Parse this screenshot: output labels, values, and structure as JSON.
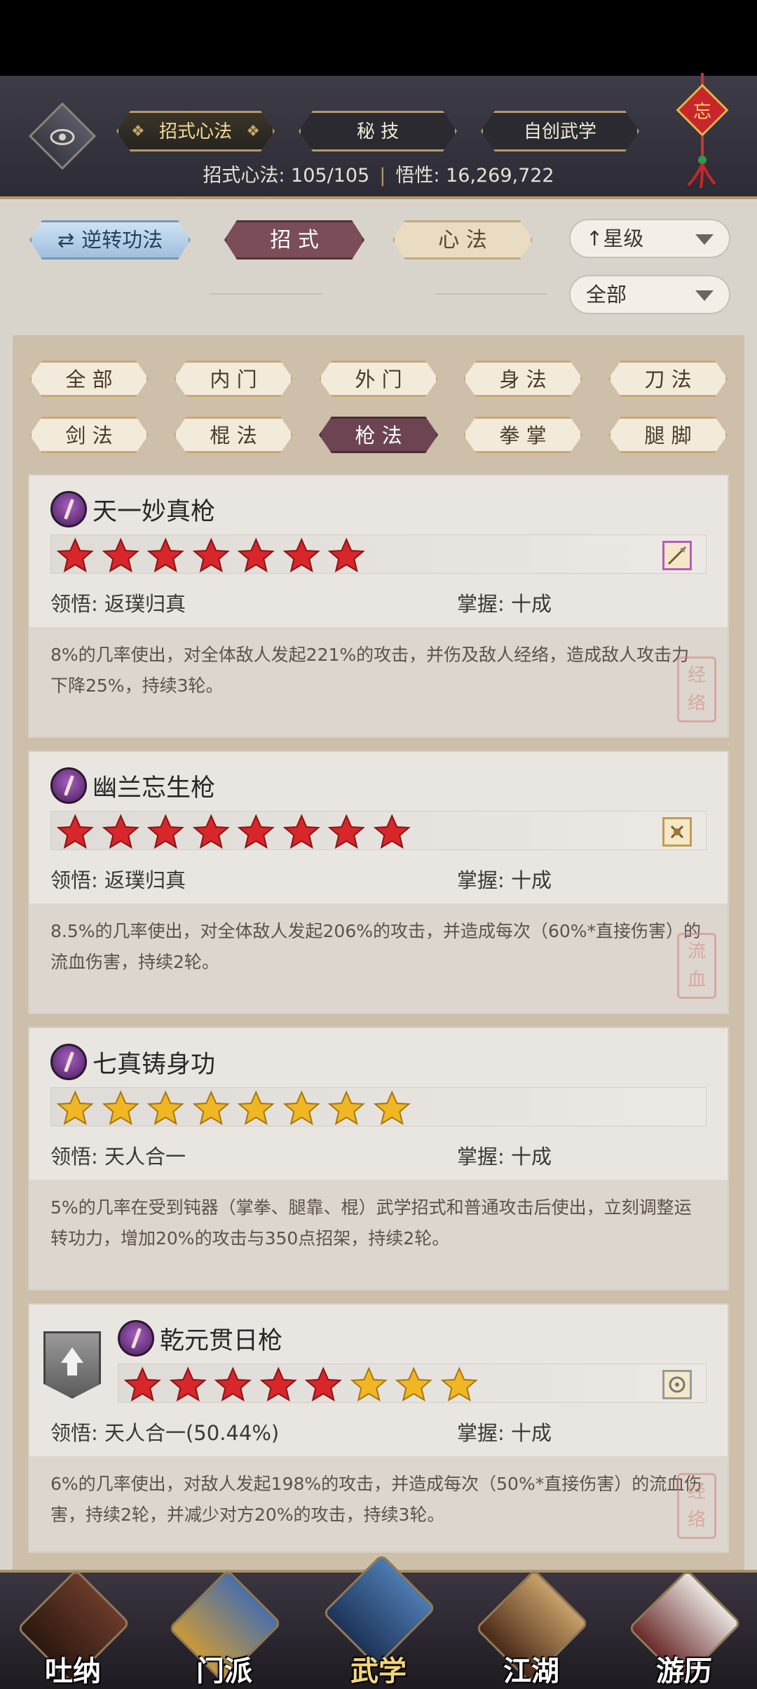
{
  "header": {
    "tabs": [
      {
        "label": "招式心法",
        "active": true
      },
      {
        "label": "秘 技",
        "active": false
      },
      {
        "label": "自创武学",
        "active": false
      }
    ],
    "stats_label": "招式心法: 105/105",
    "wisdom_label": "悟性: 16,269,722",
    "ornament_char": "忘"
  },
  "toolbar": {
    "reverse_label": "逆转功法",
    "mode_tabs": [
      {
        "label": "招 式",
        "active": true
      },
      {
        "label": "心 法",
        "active": false
      }
    ],
    "sort_label": "星级",
    "filter_label": "全部"
  },
  "filters": [
    {
      "label": "全 部",
      "active": false
    },
    {
      "label": "内 门",
      "active": false
    },
    {
      "label": "外 门",
      "active": false
    },
    {
      "label": "身 法",
      "active": false
    },
    {
      "label": "刀 法",
      "active": false
    },
    {
      "label": "剑 法",
      "active": false
    },
    {
      "label": "棍 法",
      "active": false
    },
    {
      "label": "枪 法",
      "active": true
    },
    {
      "label": "拳 掌",
      "active": false
    },
    {
      "label": "腿 脚",
      "active": false
    }
  ],
  "skills": [
    {
      "name": "天一妙真枪",
      "stars": {
        "red": 7,
        "gold": 0
      },
      "comprehension": "领悟: 返璞归真",
      "mastery": "掌握: 十成",
      "description": "8%的几率使出，对全体敌人发起221%的攻击，并伤及敌人经络，造成敌人攻击力下降25%，持续3轮。",
      "seal": "经络",
      "weapon_border": "#b65bc0"
    },
    {
      "name": "幽兰忘生枪",
      "stars": {
        "red": 8,
        "gold": 0
      },
      "comprehension": "领悟: 返璞归真",
      "mastery": "掌握: 十成",
      "description": "8.5%的几率使出，对全体敌人发起206%的攻击，并造成每次（60%*直接伤害）的流血伤害，持续2轮。",
      "seal": "流血",
      "weapon_border": "#c49a52"
    },
    {
      "name": "七真铸身功",
      "stars": {
        "red": 0,
        "gold": 8
      },
      "comprehension": "领悟: 天人合一",
      "mastery": "掌握: 十成",
      "description": "5%的几率在受到钝器（掌拳、腿靠、棍）武学招式和普通攻击后使出，立刻调整运转功力，增加20%的攻击与350点招架，持续2轮。",
      "seal": "",
      "weapon_border": ""
    },
    {
      "name": "乾元贯日枪",
      "stars": {
        "red": 5,
        "gold": 3
      },
      "comprehension": "领悟: 天人合一(50.44%)",
      "mastery": "掌握: 十成",
      "description": "6%的几率使出，对敌人发起198%的攻击，并造成每次（50%*直接伤害）的流血伤害，持续2轮，并减少对方20%的攻击，持续3轮。",
      "seal": "经络",
      "weapon_border": "#9a9a9a"
    }
  ],
  "bottom_nav": [
    {
      "label": "吐纳",
      "active": false
    },
    {
      "label": "门派",
      "active": false
    },
    {
      "label": "武学",
      "active": true
    },
    {
      "label": "江湖",
      "active": false
    },
    {
      "label": "游历",
      "active": false
    }
  ],
  "colors": {
    "star_red": "#d8262a",
    "star_gold": "#f0b624",
    "active_tab": "#7a4d58"
  }
}
